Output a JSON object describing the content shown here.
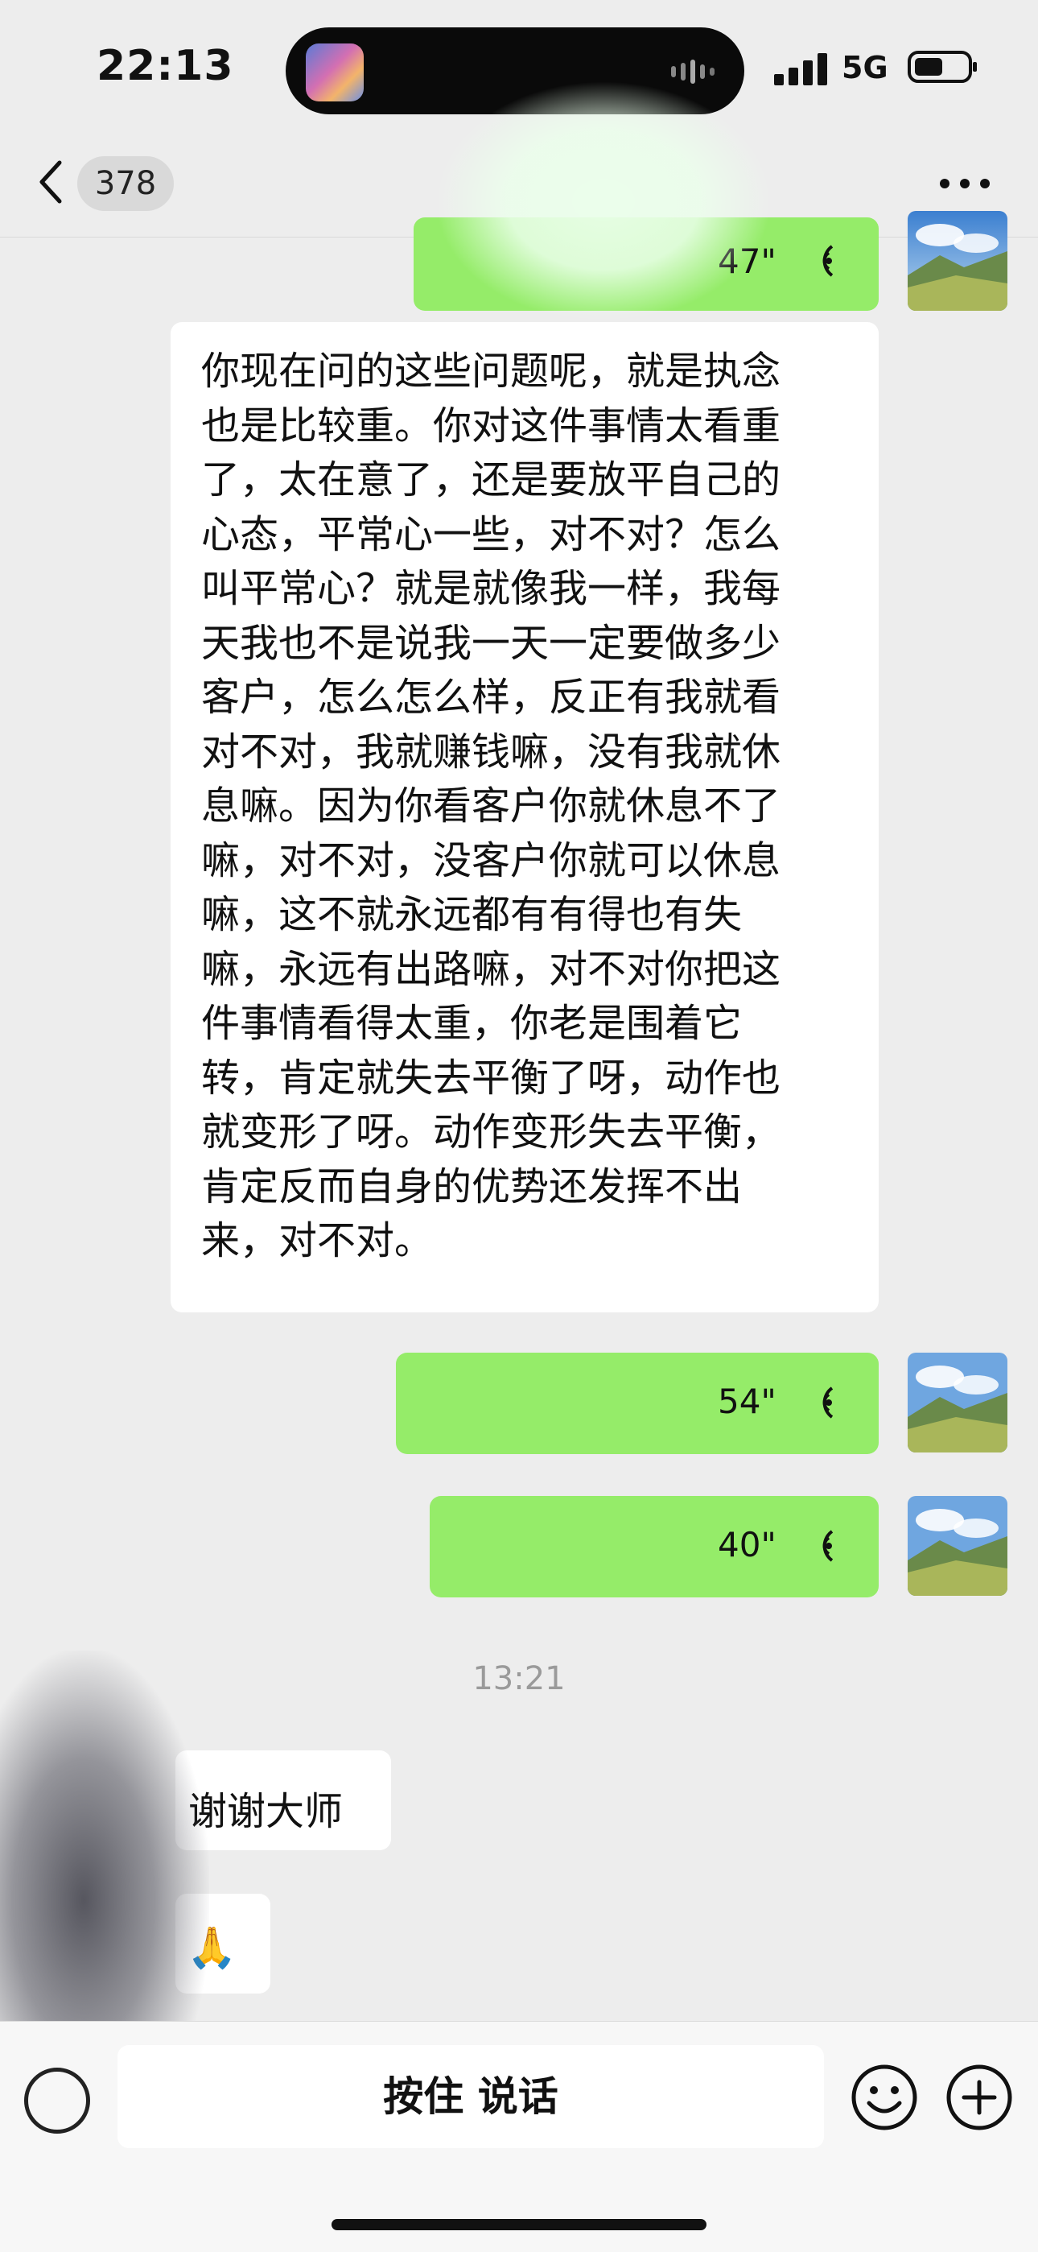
{
  "status_bar": {
    "time": "22:13",
    "network": "5G"
  },
  "header": {
    "unread_count": "378"
  },
  "messages": [
    {
      "side": "right",
      "type": "voice",
      "duration": "47\""
    },
    {
      "side": "left",
      "type": "text",
      "text": "你现在问的这些问题呢，就是执念\n也是比较重。你对这件事情太看重\n了，太在意了，还是要放平自己的\n心态，平常心一些，对不对？怎么\n叫平常心？就是就像我一样，我每\n天我也不是说我一天一定要做多少\n客户，怎么怎么样，反正有我就看\n对不对，我就赚钱嘛，没有我就休\n息嘛。因为你看客户你就休息不了\n嘛，对不对，没客户你就可以休息\n嘛，这不就永远都有有得也有失\n嘛，永远有出路嘛，对不对你把这\n件事情看得太重，你老是围着它\n转，肯定就失去平衡了呀，动作也\n就变形了呀。动作变形失去平衡，\n肯定反而自身的优势还发挥不出\n来，对不对。"
    },
    {
      "side": "right",
      "type": "voice",
      "duration": "54\""
    },
    {
      "side": "right",
      "type": "voice",
      "duration": "40\""
    },
    {
      "type": "timestamp",
      "text": "13:21"
    },
    {
      "side": "left",
      "type": "text",
      "text": "谢谢大师"
    },
    {
      "side": "left",
      "type": "emoji",
      "text": "🙏"
    }
  ],
  "input_bar": {
    "talk_label": "按住 说话"
  },
  "colors": {
    "background": "#ededed",
    "self_bubble": "#95ec69",
    "other_bubble": "#ffffff"
  }
}
